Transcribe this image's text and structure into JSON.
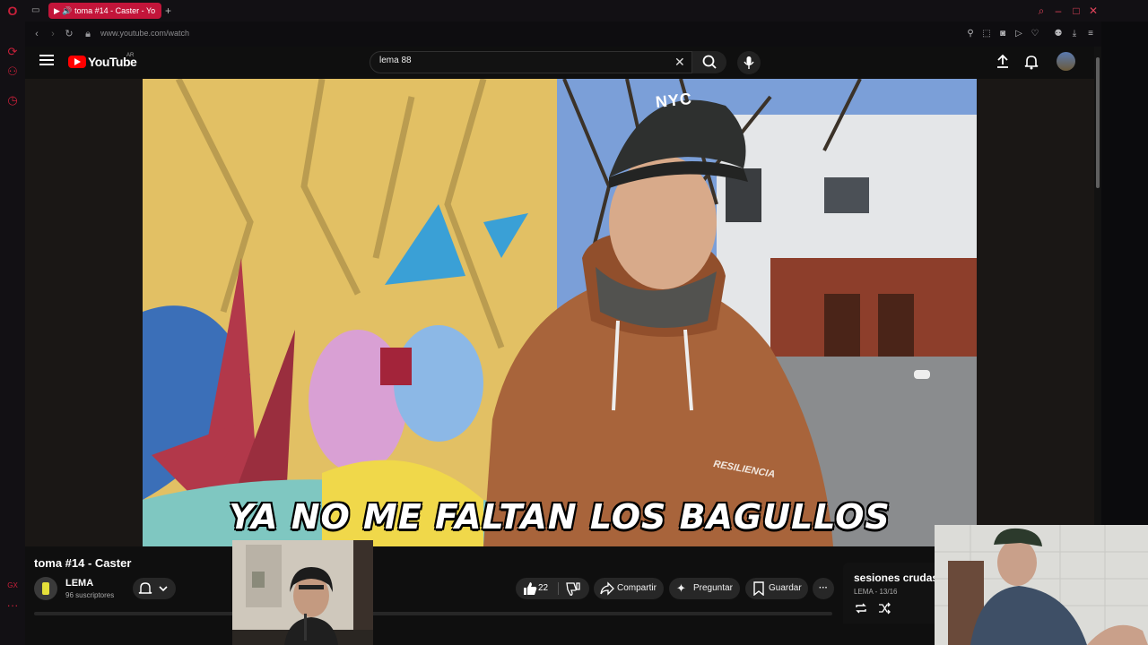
{
  "browser": {
    "tab_title": "toma #14 - Caster - Yo",
    "url": "www.youtube.com/watch"
  },
  "youtube": {
    "logo_text": "YouTube",
    "region": "AR",
    "search_query": "lema 88"
  },
  "video": {
    "subtitle": "YA NO ME FALTAN LOS BAGULLOS",
    "cap_text": "NYC",
    "hoodie_text": "RESILIENCIA"
  },
  "details": {
    "title": "toma #14 - Caster",
    "channel_name": "LEMA",
    "subscribers": "96 suscriptores",
    "likes": "22",
    "share_label": "Compartir",
    "ask_label": "Preguntar",
    "save_label": "Guardar"
  },
  "playlist": {
    "title": "sesiones crudas",
    "meta": "LEMA - 13/16"
  },
  "colors": {
    "opera_red": "#c3153a",
    "yt_red": "#ff0000",
    "yt_bg": "#0f0f0f"
  }
}
